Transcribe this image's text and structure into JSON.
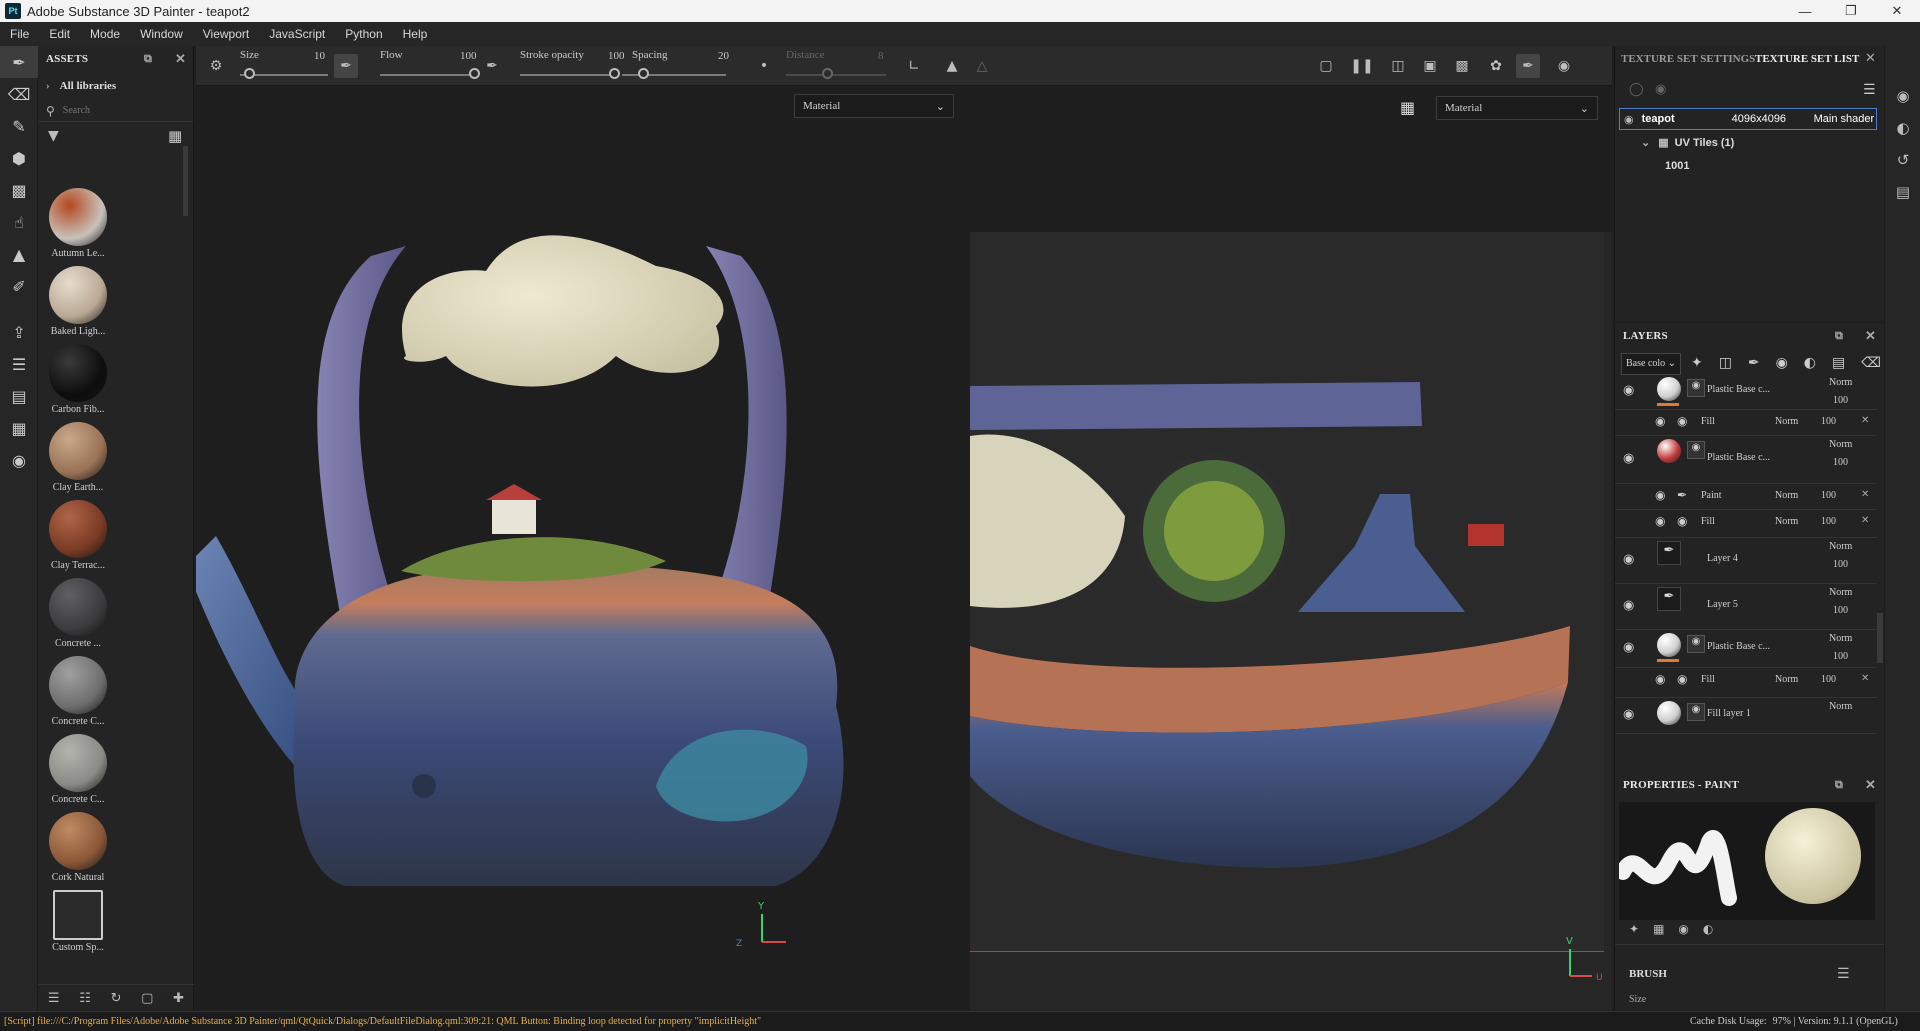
{
  "window": {
    "title": "Adobe Substance 3D Painter - teapot2",
    "logo": "Pt"
  },
  "menu": [
    "File",
    "Edit",
    "Mode",
    "Window",
    "Viewport",
    "JavaScript",
    "Python",
    "Help"
  ],
  "toolbar": {
    "size_label": "Size",
    "size_value": "10",
    "size_level": 0.1,
    "flow_label": "Flow",
    "flow_value": "100",
    "flow_level": 1.0,
    "opacity_label": "Stroke opacity",
    "opacity_value": "100",
    "opacity_level": 1.0,
    "spacing_label": "Spacing",
    "spacing_value": "20",
    "spacing_level": 0.2,
    "distance_label": "Distance",
    "distance_value": "8"
  },
  "assets": {
    "title": "ASSETS",
    "library": "All libraries",
    "search_placeholder": "Search",
    "materials": [
      {
        "label": "Autumn Le...",
        "color": "#c8c2bb",
        "accent": "#b5481e"
      },
      {
        "label": "Baked Ligh...",
        "color": "#b9a894",
        "accent": "#e6dccd"
      },
      {
        "label": "Carbon Fib...",
        "color": "#0e0e0e",
        "accent": "#3a3a3a"
      },
      {
        "label": "Clay Earth...",
        "color": "#9a7256",
        "accent": "#c9a88a"
      },
      {
        "label": "Clay Terrac...",
        "color": "#7a3a24",
        "accent": "#b06548"
      },
      {
        "label": "Concrete ...",
        "color": "#3c3c3e",
        "accent": "#606064"
      },
      {
        "label": "Concrete C...",
        "color": "#6e6e6e",
        "accent": "#a0a0a0"
      },
      {
        "label": "Concrete C...",
        "color": "#8a8a86",
        "accent": "#b4b4ae"
      },
      {
        "label": "Cork Natural",
        "color": "#8a5838",
        "accent": "#c08a62"
      },
      {
        "label": "Custom Sp...",
        "color": "",
        "accent": ""
      }
    ]
  },
  "viewport3d": {
    "dropdown": "Material"
  },
  "viewport2d": {
    "dropdown": "Material"
  },
  "texture_set": {
    "tab_settings": "TEXTURE SET SETTINGS",
    "tab_list": "TEXTURE SET LIST",
    "name": "teapot",
    "resolution": "4096x4096",
    "shader": "Main shader",
    "uv_tiles": "UV Tiles (1)",
    "tile": "1001"
  },
  "layers": {
    "title": "LAYERS",
    "channel": "Base colo",
    "rows": [
      {
        "name": "Plastic Base c...",
        "blend": "Norm",
        "opacity": "100"
      },
      {
        "name": "Fill",
        "blend": "Norm",
        "opacity": "100"
      },
      {
        "name": "Plastic Base c...",
        "blend": "Norm",
        "opacity": "100"
      },
      {
        "name": "Paint",
        "blend": "Norm",
        "opacity": "100"
      },
      {
        "name": "Fill",
        "blend": "Norm",
        "opacity": "100"
      },
      {
        "name": "Layer 4",
        "blend": "Norm",
        "opacity": "100"
      },
      {
        "name": "Layer 5",
        "blend": "Norm",
        "opacity": "100"
      },
      {
        "name": "Plastic Base c...",
        "blend": "Norm",
        "opacity": "100"
      },
      {
        "name": "Fill",
        "blend": "Norm",
        "opacity": "100"
      },
      {
        "name": "Fill layer 1",
        "blend": "Norm",
        "opacity": ""
      }
    ]
  },
  "properties": {
    "title": "PROPERTIES - PAINT",
    "section": "BRUSH",
    "size_label": "Size"
  },
  "status": {
    "message": "[Script] file:///C:/Program Files/Adobe/Adobe Substance 3D Painter/qml/QtQuick/Dialogs/DefaultFileDialog.qml:309:21: QML Button: Binding loop detected for property \"implicitHeight\"",
    "cache": "Cache Disk Usage:",
    "version": "97% | Version: 9.1.1 (OpenGL)"
  },
  "colors": {
    "accent": "#e8772e",
    "selection": "#4a7fd0",
    "message": "#e8b04a"
  }
}
